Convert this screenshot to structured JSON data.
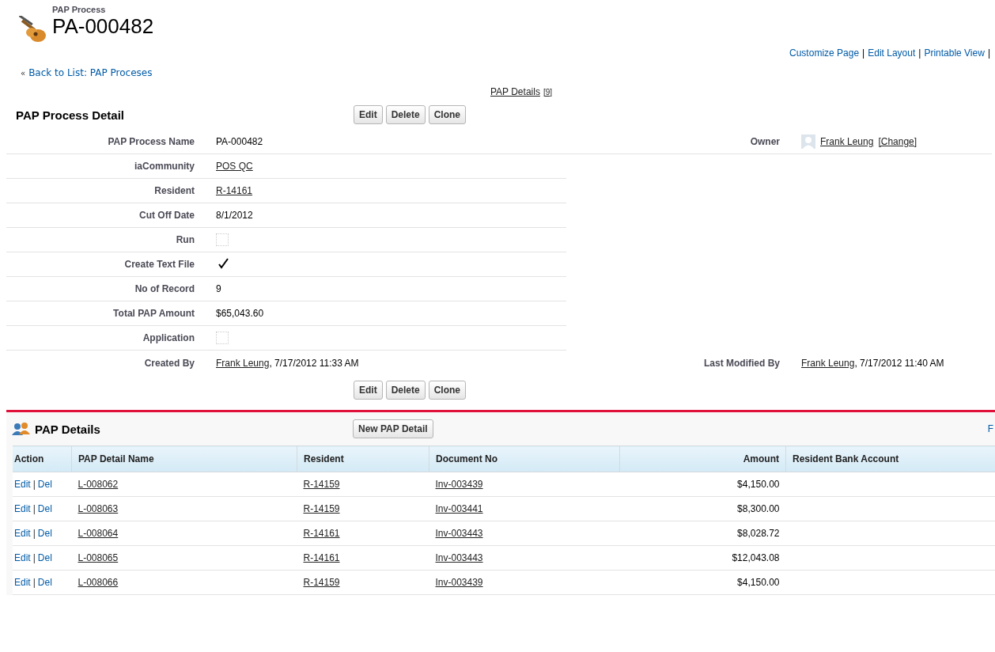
{
  "header": {
    "object_type": "PAP Process",
    "record_name": "PA-000482"
  },
  "top_links": [
    {
      "label": "Customize Page",
      "kind": "link"
    },
    {
      "label": "|",
      "kind": "separator"
    },
    {
      "label": "Edit Layout",
      "kind": "link"
    },
    {
      "label": "|",
      "kind": "separator"
    },
    {
      "label": "Printable View",
      "kind": "link"
    },
    {
      "label": "|",
      "kind": "separator"
    }
  ],
  "back_link": {
    "prefix": "«",
    "label": "Back to List: PAP Proceses"
  },
  "related_links": [
    {
      "label": "PAP Details",
      "count": "[9]"
    }
  ],
  "detail": {
    "title": "PAP Process Detail",
    "buttons": [
      "Edit",
      "Delete",
      "Clone"
    ],
    "bottom_buttons": [
      "Edit",
      "Delete",
      "Clone"
    ],
    "rows": [
      {
        "left": {
          "label": "PAP Process Name",
          "kind": "parts",
          "parts": [
            {
              "text": "PA-000482",
              "link": false
            }
          ]
        },
        "right": {
          "label": "Owner",
          "kind": "parts",
          "avatar": true,
          "parts": [
            {
              "text": "Frank Leung",
              "link": true
            },
            {
              "text": "[Change]",
              "link": true
            }
          ]
        }
      },
      {
        "left": {
          "label": "iaCommunity",
          "kind": "parts",
          "parts": [
            {
              "text": "POS QC",
              "link": true
            }
          ]
        }
      },
      {
        "left": {
          "label": "Resident",
          "kind": "parts",
          "parts": [
            {
              "text": "R-14161",
              "link": true
            }
          ]
        }
      },
      {
        "left": {
          "label": "Cut Off Date",
          "kind": "parts",
          "parts": [
            {
              "text": "8/1/2012",
              "link": false
            }
          ]
        }
      },
      {
        "left": {
          "label": "Run",
          "kind": "checkbox",
          "checked": false
        }
      },
      {
        "left": {
          "label": "Create Text File",
          "kind": "checkbox",
          "checked": true
        }
      },
      {
        "left": {
          "label": "No of Record",
          "kind": "parts",
          "parts": [
            {
              "text": "9",
              "link": false
            }
          ]
        }
      },
      {
        "left": {
          "label": "Total PAP Amount",
          "kind": "parts",
          "parts": [
            {
              "text": "$65,043.60",
              "link": false
            }
          ]
        }
      },
      {
        "left": {
          "label": "Application",
          "kind": "checkbox",
          "checked": false
        }
      },
      {
        "left": {
          "label": "Created By",
          "kind": "parts",
          "parts": [
            {
              "text": "Frank Leung",
              "link": true
            },
            {
              "text": ", 7/17/2012 11:33 AM",
              "link": false
            }
          ]
        },
        "right": {
          "label": "Last Modified By",
          "kind": "parts",
          "parts": [
            {
              "text": "Frank Leung",
              "link": true
            },
            {
              "text": ", 7/17/2012 11:40 AM",
              "link": false
            }
          ]
        }
      }
    ]
  },
  "related_list": {
    "title": "PAP Details",
    "button": "New PAP Detail",
    "edge_link": "F",
    "action_column": "Action",
    "columns": [
      {
        "label": "PAP Detail Name",
        "kind": "link"
      },
      {
        "label": "Resident",
        "kind": "link"
      },
      {
        "label": "Document No",
        "kind": "link"
      },
      {
        "label": "Amount",
        "kind": "currency"
      },
      {
        "label": "Resident Bank Account",
        "kind": "text"
      }
    ],
    "rows": [
      {
        "actions": [
          {
            "label": "Edit",
            "kind": "link"
          },
          {
            "label": "|",
            "kind": "separator"
          },
          {
            "label": "Del",
            "kind": "link"
          }
        ],
        "cells": [
          "L-008062",
          "R-14159",
          "Inv-003439",
          "$4,150.00"
        ]
      },
      {
        "actions": [
          {
            "label": "Edit",
            "kind": "link"
          },
          {
            "label": "|",
            "kind": "separator"
          },
          {
            "label": "Del",
            "kind": "link"
          }
        ],
        "cells": [
          "L-008063",
          "R-14159",
          "Inv-003441",
          "$8,300.00"
        ]
      },
      {
        "actions": [
          {
            "label": "Edit",
            "kind": "link"
          },
          {
            "label": "|",
            "kind": "separator"
          },
          {
            "label": "Del",
            "kind": "link"
          }
        ],
        "cells": [
          "L-008064",
          "R-14161",
          "Inv-003443",
          "$8,028.72"
        ]
      },
      {
        "actions": [
          {
            "label": "Edit",
            "kind": "link"
          },
          {
            "label": "|",
            "kind": "separator"
          },
          {
            "label": "Del",
            "kind": "link"
          }
        ],
        "cells": [
          "L-008065",
          "R-14161",
          "Inv-003443",
          "$12,043.08"
        ]
      },
      {
        "actions": [
          {
            "label": "Edit",
            "kind": "link"
          },
          {
            "label": "|",
            "kind": "separator"
          },
          {
            "label": "Del",
            "kind": "link"
          }
        ],
        "cells": [
          "L-008066",
          "R-14159",
          "Inv-003439",
          "$4,150.00"
        ]
      }
    ]
  }
}
